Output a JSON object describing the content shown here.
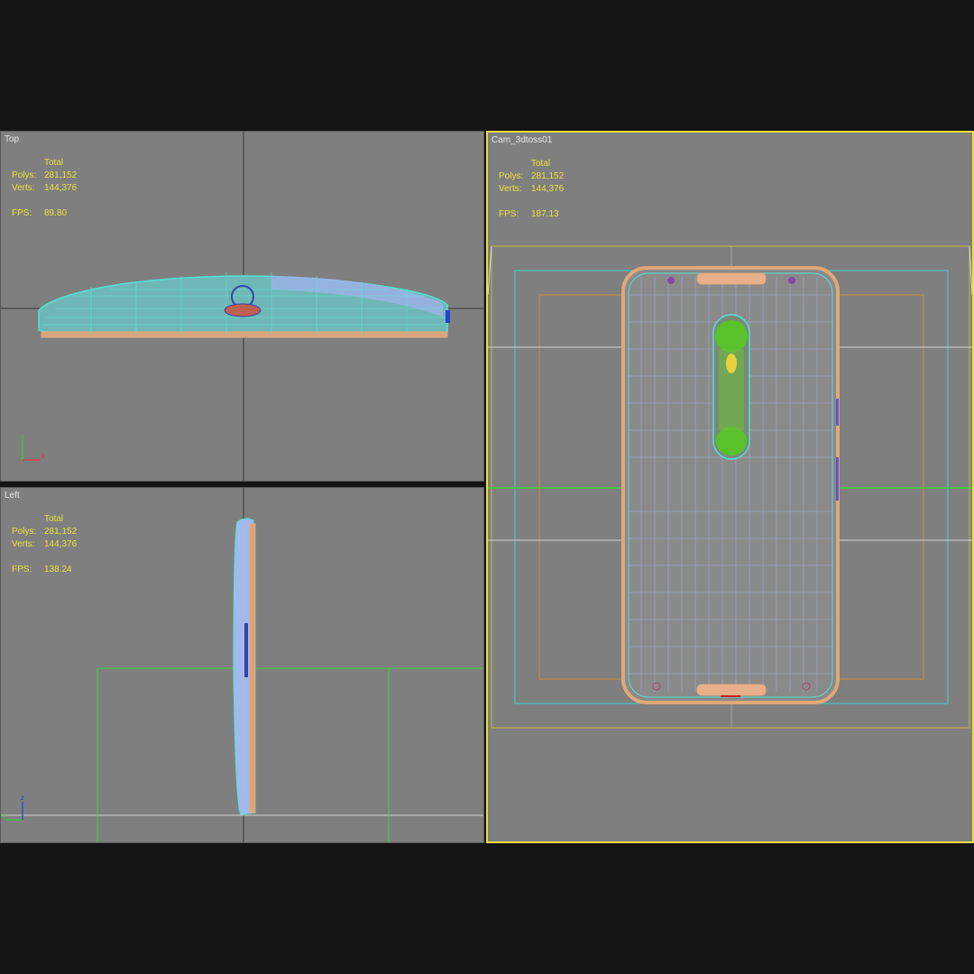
{
  "viewports": {
    "top": {
      "label": "Top",
      "total_label": "Total",
      "polys_label": "Polys:",
      "polys": "281,152",
      "verts_label": "Verts:",
      "verts": "144,376",
      "fps_label": "FPS:",
      "fps": "89.80",
      "axis": {
        "up": "y",
        "right": "x"
      }
    },
    "left": {
      "label": "Left",
      "total_label": "Total",
      "polys_label": "Polys:",
      "polys": "281,152",
      "verts_label": "Verts:",
      "verts": "144,376",
      "fps_label": "FPS:",
      "fps": "138.24",
      "axis": {
        "up": "z",
        "right": "y"
      }
    },
    "camera": {
      "label": "Cam_3dtoss01",
      "total_label": "Total",
      "polys_label": "Polys:",
      "polys": "281,152",
      "verts_label": "Verts:",
      "verts": "144,376",
      "fps_label": "FPS:",
      "fps": "187.13",
      "active": true
    }
  },
  "colors": {
    "viewport_bg": "#7f7f7f",
    "active_border": "#e8df3a",
    "stats_text": "#e8e23c",
    "wire_cyan": "#55e0d8",
    "wire_orange": "#e0a878",
    "wire_blue": "#a8b8f0",
    "grid_line": "#c8c8c8",
    "green_line": "#39d639"
  }
}
